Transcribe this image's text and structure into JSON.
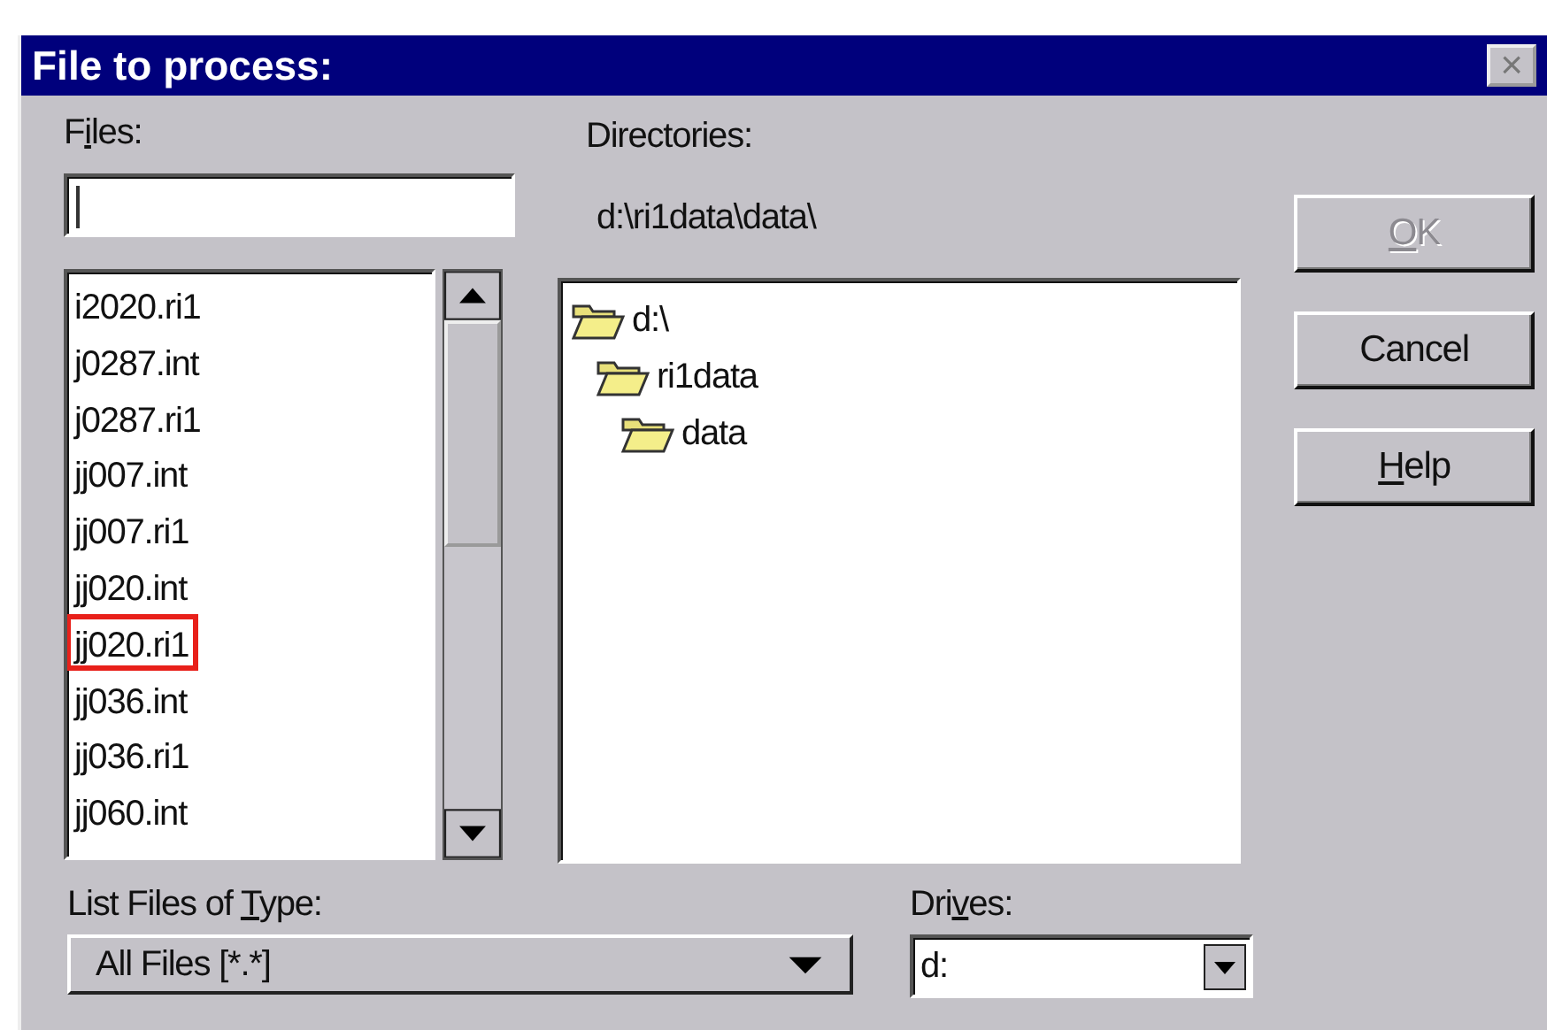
{
  "window": {
    "title": "File to process:",
    "close": "×"
  },
  "files": {
    "label": {
      "before": "F",
      "key": "i",
      "after": "les:"
    },
    "items": [
      {
        "name": "i2020.ri1",
        "highlighted": false
      },
      {
        "name": "j0287.int",
        "highlighted": false
      },
      {
        "name": "j0287.ri1",
        "highlighted": false
      },
      {
        "name": "jj007.int",
        "highlighted": false
      },
      {
        "name": "jj007.ri1",
        "highlighted": false
      },
      {
        "name": "jj020.int",
        "highlighted": false
      },
      {
        "name": "jj020.ri1",
        "highlighted": true
      },
      {
        "name": "jj036.int",
        "highlighted": false
      },
      {
        "name": "jj036.ri1",
        "highlighted": false
      },
      {
        "name": "jj060.int",
        "highlighted": false
      }
    ]
  },
  "directories": {
    "label": "Directories:",
    "path": "d:\\ri1data\\data\\",
    "tree": [
      {
        "name": "d:\\",
        "children": [
          {
            "name": "ri1data",
            "children": [
              {
                "name": "data"
              }
            ]
          }
        ]
      }
    ]
  },
  "buttons": [
    {
      "key": "O",
      "after": "K",
      "disabled": true
    },
    {
      "before": "Cancel",
      "disabled": false
    },
    {
      "key": "H",
      "after": "elp",
      "disabled": false
    }
  ],
  "type": {
    "label": {
      "before": "List Files of ",
      "key": "T",
      "after": "ype:"
    },
    "value": "All Files [*.*]"
  },
  "drives": {
    "label": {
      "before": "Dri",
      "key": "v",
      "after": "es:"
    },
    "value": "d:"
  }
}
